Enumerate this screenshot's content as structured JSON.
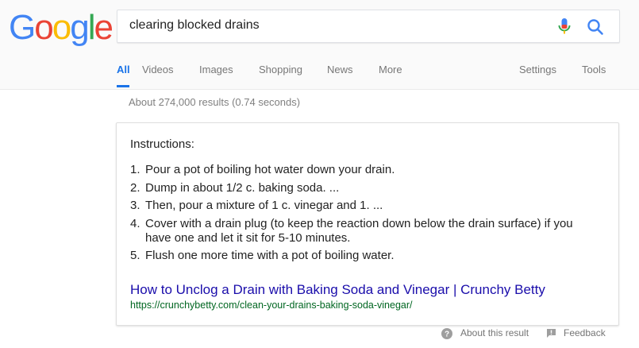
{
  "logo": {
    "letters": [
      "G",
      "o",
      "o",
      "g",
      "l",
      "e"
    ]
  },
  "search": {
    "query": "clearing blocked drains"
  },
  "icons": {
    "mic": "microphone-icon",
    "search": "magnifier-icon",
    "about": "question-icon",
    "feedback": "feedback-flag-icon"
  },
  "tabs": [
    {
      "label": "All",
      "active": true
    },
    {
      "label": "Videos"
    },
    {
      "label": "Images"
    },
    {
      "label": "Shopping"
    },
    {
      "label": "News"
    },
    {
      "label": "More"
    },
    {
      "label": "Settings"
    },
    {
      "label": "Tools"
    }
  ],
  "stats": "About 274,000 results (0.74 seconds)",
  "snippet": {
    "heading": "Instructions:",
    "steps": [
      {
        "num": "1.",
        "text": "Pour a pot of boiling hot water down your drain."
      },
      {
        "num": "2.",
        "text": "Dump in about 1/2 c. baking soda. ..."
      },
      {
        "num": "3.",
        "text": "Then, pour a mixture of 1 c. vinegar and 1. ..."
      },
      {
        "num": "4.",
        "text": "Cover with a drain plug (to keep the reaction down below the drain surface) if you have one and let it sit for 5-10 minutes."
      },
      {
        "num": "5.",
        "text": "Flush one more time with a pot of boiling water."
      }
    ],
    "link_title": "How to Unclog a Drain with Baking Soda and Vinegar | Crunchy Betty",
    "url": "https://crunchybetty.com/clean-your-drains-baking-soda-vinegar/"
  },
  "footer": {
    "about": "About this result",
    "feedback": "Feedback"
  },
  "colors": {
    "blue": "#4285f4",
    "red": "#ea4335",
    "yellow": "#fbbc05",
    "green": "#34a853",
    "link": "#1a0dab",
    "url": "#006621",
    "tab_active": "#1a73e8"
  }
}
